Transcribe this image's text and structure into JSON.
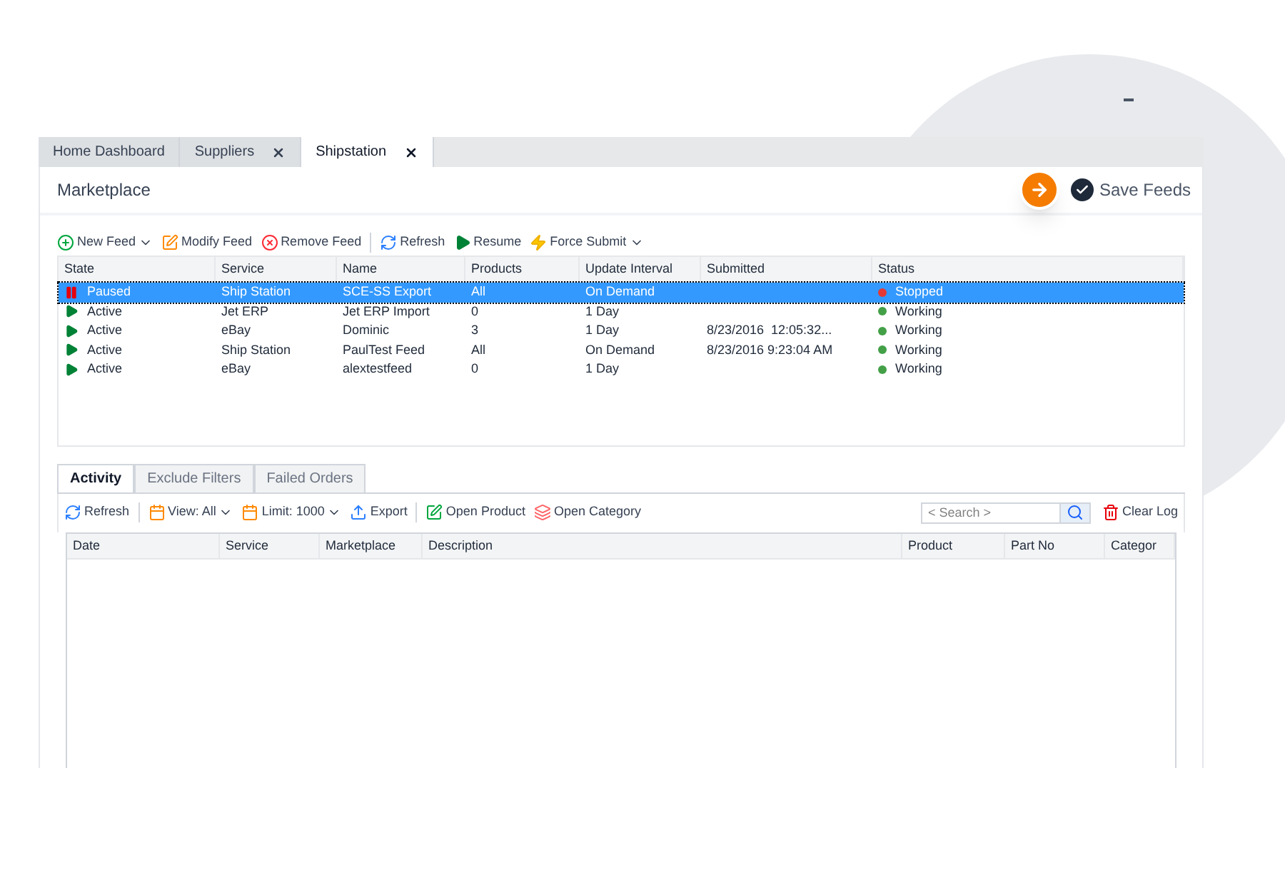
{
  "tabs": [
    {
      "label": "Home Dashboard",
      "closable": false,
      "selected": false
    },
    {
      "label": "Suppliers",
      "closable": true,
      "selected": false
    },
    {
      "label": "Shipstation",
      "closable": true,
      "selected": true
    }
  ],
  "header": {
    "title": "Marketplace",
    "save_label": "Save Feeds"
  },
  "feed_toolbar": [
    {
      "kind": "add",
      "label": "New Feed",
      "dropdown": true,
      "separator_before": false
    },
    {
      "kind": "edit",
      "label": "Modify Feed",
      "dropdown": false,
      "separator_before": false
    },
    {
      "kind": "remove",
      "label": "Remove Feed",
      "dropdown": false,
      "separator_before": false
    },
    {
      "kind": "refresh",
      "label": "Refresh",
      "dropdown": false,
      "separator_before": true
    },
    {
      "kind": "resume",
      "label": "Resume",
      "dropdown": false,
      "separator_before": false
    },
    {
      "kind": "force",
      "label": "Force Submit",
      "dropdown": true,
      "separator_before": false
    }
  ],
  "feeds": {
    "columns": [
      "State",
      "Service",
      "Name",
      "Products",
      "Update Interval",
      "Submitted",
      "Status"
    ],
    "rows": [
      {
        "selected": true,
        "kind": "paused",
        "state": "Paused",
        "service": "Ship Station",
        "name": "SCE-SS Export",
        "products": "All",
        "interval": "On Demand",
        "submitted": "",
        "color": "#e53935",
        "status": "Stopped"
      },
      {
        "selected": false,
        "kind": "active",
        "state": "Active",
        "service": "Jet ERP",
        "name": "Jet ERP Import",
        "products": "0",
        "interval": "1 Day",
        "submitted": "",
        "color": "#43a047",
        "status": "Working"
      },
      {
        "selected": false,
        "kind": "active",
        "state": "Active",
        "service": "eBay",
        "name": "Dominic",
        "products": "3",
        "interval": "1 Day",
        "submitted": "8/23/2016  12:05:32...",
        "color": "#43a047",
        "status": "Working"
      },
      {
        "selected": false,
        "kind": "active",
        "state": "Active",
        "service": "Ship Station",
        "name": "PaulTest Feed",
        "products": "All",
        "interval": "On Demand",
        "submitted": "8/23/2016 9:23:04 AM",
        "color": "#43a047",
        "status": "Working"
      },
      {
        "selected": false,
        "kind": "active",
        "state": "Active",
        "service": "eBay",
        "name": "alextestfeed",
        "products": "0",
        "interval": "1 Day",
        "submitted": "",
        "color": "#43a047",
        "status": "Working"
      }
    ]
  },
  "bottom_tabs": [
    {
      "label": "Activity",
      "selected": true
    },
    {
      "label": "Exclude Filters",
      "selected": false
    },
    {
      "label": "Failed Orders",
      "selected": false
    }
  ],
  "activity_toolbar": [
    {
      "kind": "refresh",
      "label": "Refresh",
      "dropdown": false,
      "separator_before": false
    },
    {
      "kind": "calendar",
      "label": "View: All",
      "dropdown": true,
      "separator_before": true
    },
    {
      "kind": "calendar",
      "label": "Limit: 1000",
      "dropdown": true,
      "separator_before": false
    },
    {
      "kind": "export",
      "label": "Export",
      "dropdown": false,
      "separator_before": false
    },
    {
      "kind": "product",
      "label": "Open Product",
      "dropdown": false,
      "separator_before": true
    },
    {
      "kind": "category",
      "label": "Open Category",
      "dropdown": false,
      "separator_before": false
    }
  ],
  "search": {
    "placeholder": "< Search >"
  },
  "clear_log": "Clear Log",
  "activity_columns": [
    "Date",
    "Service",
    "Marketplace",
    "Description",
    "Product",
    "Part No",
    "Categor"
  ]
}
